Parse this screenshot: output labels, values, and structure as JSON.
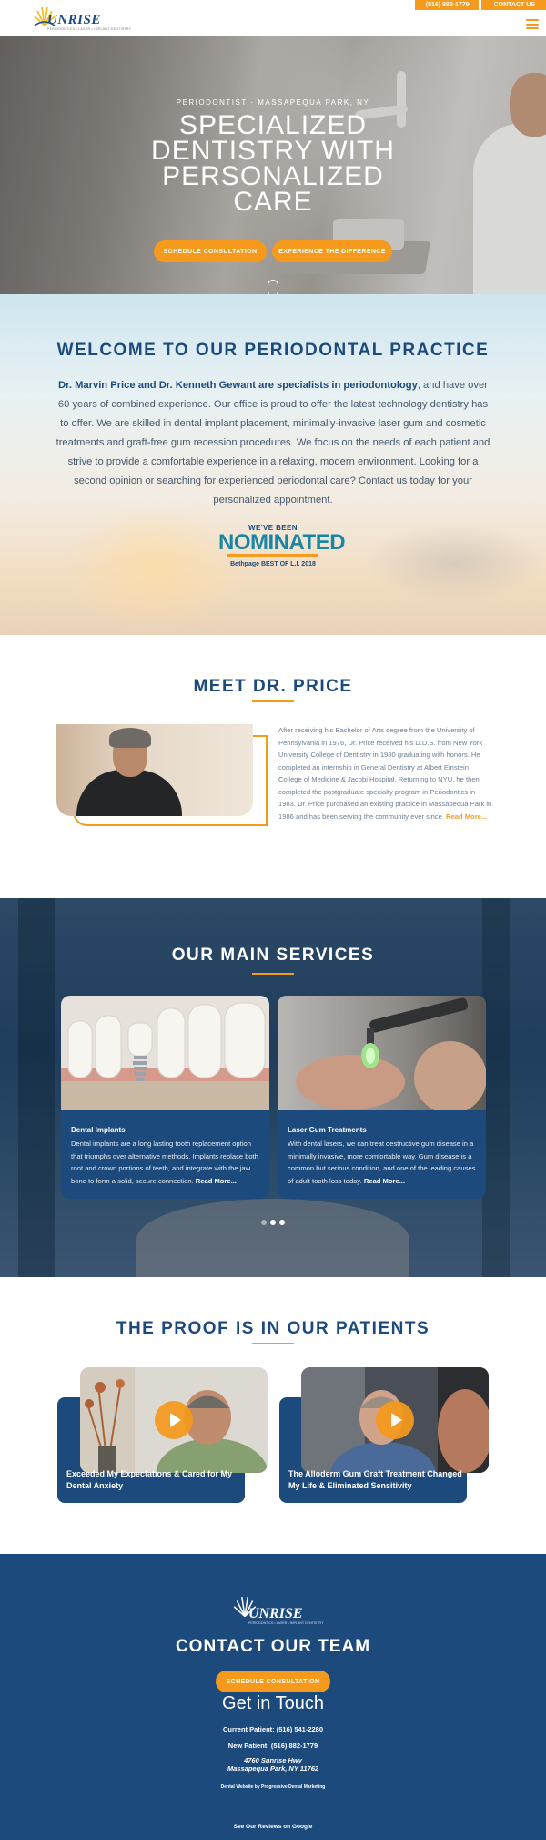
{
  "header": {
    "logo_text": "UNRISE",
    "logo_sub": "PERIODONTICS • LASER • IMPLANT DENTISTRY",
    "phone": "(516) 882-1779",
    "contact_label": "CONTACT US"
  },
  "hero": {
    "subtitle": "PERIODONTIST · MASSAPEQUA PARK, NY",
    "title": "SPECIALIZED DENTISTRY WITH PERSONALIZED CARE",
    "btn_schedule": "SCHEDULE CONSULTATION",
    "btn_experience": "EXPERIENCE THE DIFFERENCE"
  },
  "welcome": {
    "title": "WELCOME TO OUR PERIODONTAL PRACTICE",
    "lead_bold": "Dr. Marvin Price and Dr. Kenneth Gewant are specialists in periodontology",
    "body": ", and have over 60 years of combined experience. Our office is proud to offer the latest technology dentistry has to offer. We are skilled in dental implant placement, minimally-invasive laser gum and cosmetic treatments and graft-free gum recession procedures. We focus on the needs of each patient and strive to provide a comfortable experience in a relaxing, modern environment. Looking for a second opinion or searching for experienced periodontal care? Contact us today for your personalized appointment.",
    "badge_top": "WE'VE BEEN",
    "badge_main": "NOMINATED",
    "badge_bottom": "Bethpage BEST OF L.I. 2018"
  },
  "meet": {
    "title": "MEET DR. PRICE",
    "body": "After receiving his Bachelor of Arts degree from the University of Pennsylvania in 1976, Dr. Price received his D.D.S. from New York University College of Dentistry in 1980 graduating with honors. He completed an internship in General Dentistry at Albert Einstein College of Medicine & Jacobi Hospital. Returning to NYU, he then completed the postgraduate specialty program in Periodontics in 1983. Dr. Price purchased an existing practice in Massapequa Park in 1986 and has been serving the community ever since. ",
    "read_more": "Read More..."
  },
  "services": {
    "title": "OUR MAIN SERVICES",
    "cards": [
      {
        "title": "Dental Implants",
        "body": "Dental implants are a long lasting tooth replacement option that triumphs over alternative methods. Implants replace both root and crown portions of teeth, and integrate with the jaw bone to form a solid, secure connection. ",
        "read_more": "Read More..."
      },
      {
        "title": "Laser Gum Treatments",
        "body": "With dental lasers, we can treat destructive gum disease in a minimally invasive, more comfortable way. Gum disease is a common but serious condition, and one of the leading causes of adult tooth loss today. ",
        "read_more": "Read More..."
      }
    ]
  },
  "patients": {
    "title": "THE PROOF IS IN OUR PATIENTS",
    "videos": [
      {
        "title": "Exceeded My Expectations & Cared for My Dental Anxiety"
      },
      {
        "title": "The Alloderm Gum Graft Treatment Changed My Life & Eliminated Sensitivity"
      }
    ]
  },
  "footer": {
    "logo_text": "UNRISE",
    "logo_sub": "PERIODONTICS • LASER • IMPLANT DENTISTRY",
    "title": "CONTACT OUR TEAM",
    "btn_schedule": "SCHEDULE CONSULTATION",
    "get_in_touch": "Get in Touch",
    "current_patient": "Current Patient: (516) 541-2280",
    "new_patient": "New Patient: (516) 882-1779",
    "address_line1": "4760 Sunrise Hwy",
    "address_line2": "Massapequa Park, NY 11762",
    "credit": "Dental Website by Progressive Dental Marketing",
    "reviews": "See Our Reviews on Google"
  },
  "colors": {
    "brand_blue": "#1d4a7c",
    "accent_orange": "#f59a1c"
  }
}
